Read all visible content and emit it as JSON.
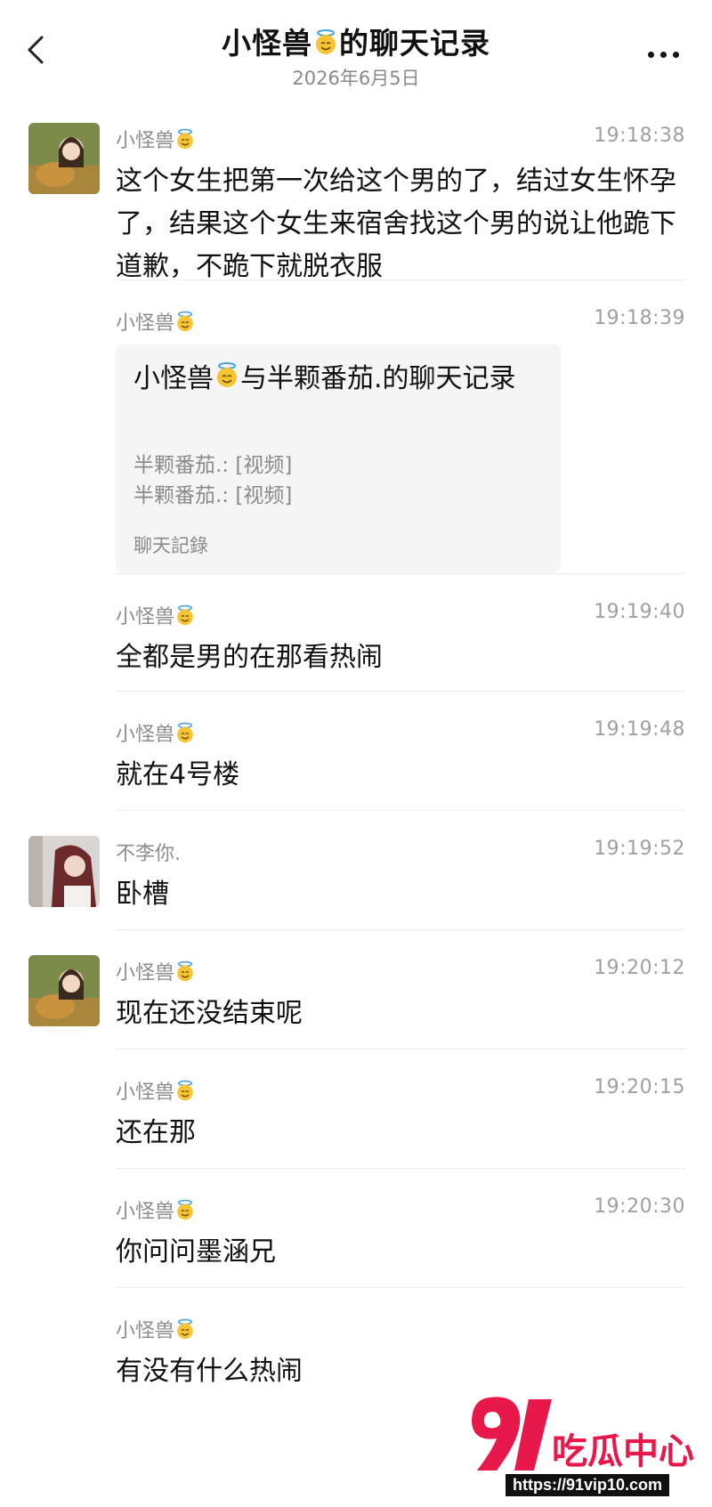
{
  "header": {
    "title_prefix": "小怪兽",
    "title_suffix": "的聊天记录",
    "date": "2026年6月5日",
    "back_icon": "chevron-left-icon",
    "more_icon": "more-horizontal-icon"
  },
  "messages": [
    {
      "sender": "小怪兽",
      "time": "19:18:38",
      "text": "这个女生把第一次给这个男的了，结过女生怀孕了，结果这个女生来宿舍找这个男的说让他跪下道歉，不跪下就脱衣服"
    },
    {
      "sender": "小怪兽",
      "time": "19:18:39",
      "card": {
        "title_prefix": "小怪兽",
        "title_suffix": "与半颗番茄.的聊天记录",
        "lines": [
          "半颗番茄.: [视频]",
          "半颗番茄.: [视频]"
        ],
        "footer": "聊天記錄"
      }
    },
    {
      "sender": "小怪兽",
      "time": "19:19:40",
      "text": "全都是男的在那看热闹"
    },
    {
      "sender": "小怪兽",
      "time": "19:19:48",
      "text": "就在4号楼"
    },
    {
      "sender": "不李你.",
      "time": "19:19:52",
      "text": "卧槽"
    },
    {
      "sender": "小怪兽",
      "time": "19:20:12",
      "text": "现在还没结束呢"
    },
    {
      "sender": "小怪兽",
      "time": "19:20:15",
      "text": "还在那"
    },
    {
      "sender": "小怪兽",
      "time": "19:20:30",
      "text": "你问问墨涵兄"
    },
    {
      "sender": "小怪兽",
      "time": "",
      "text": "有没有什么热闹"
    }
  ],
  "watermark": {
    "brand": "吃瓜中心",
    "url": "https://91vip10.com",
    "accent_color": "#e8184a"
  },
  "colors": {
    "text": "#111111",
    "meta": "#8c8c8c",
    "card_bg": "#f5f5f5",
    "divider": "#e9e9e9"
  }
}
